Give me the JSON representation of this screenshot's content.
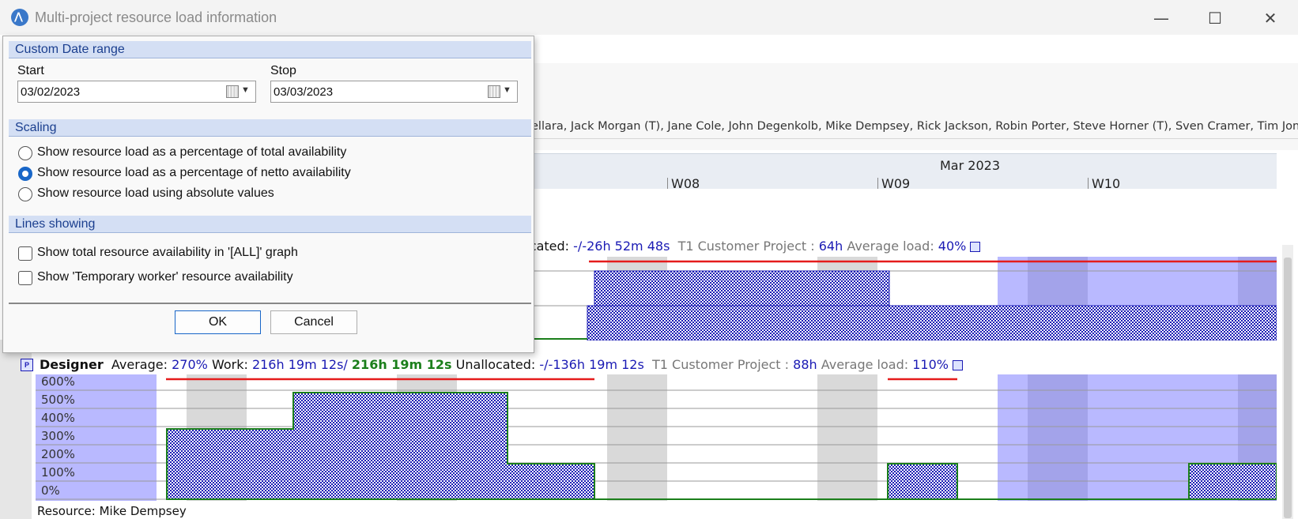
{
  "window": {
    "title": "Multi-project resource load information",
    "minimize": "—",
    "maximize": "☐",
    "close": "✕"
  },
  "resource_names": "ellara, Jack Morgan (T), Jane Cole, John Degenkolb, Mike Dempsey, Rick Jackson, Robin Porter, Steve Horner (T), Sven Cramer, Tim Jones",
  "timeline": {
    "month": "Mar 2023",
    "weeks": [
      "W08",
      "W09",
      "W10"
    ]
  },
  "top_row": {
    "unallocated_label": "ocated:",
    "unallocated_value": "-/-26h 52m 48s",
    "project_label": "T1 Customer Project :",
    "project_value": "64h",
    "avg_load_label": "Average load:",
    "avg_load_value": "40%"
  },
  "designer_row": {
    "name": "Designer",
    "average_label": "Average:",
    "average_value": "270%",
    "work_label": "Work:",
    "work_value": "216h 19m 12s/",
    "work_value2": "216h 19m 12s",
    "unallocated_label": "Unallocated:",
    "unallocated_value": "-/-136h 19m 12s",
    "project_label": "T1 Customer Project :",
    "project_value": "88h",
    "avg_load_label": "Average load:",
    "avg_load_value": "110%",
    "y_labels": [
      "600%",
      "500%",
      "400%",
      "300%",
      "200%",
      "100%",
      "0%"
    ]
  },
  "footer": "Resource: Mike Dempsey",
  "dialog": {
    "date_section": "Custom Date range",
    "start_label": "Start",
    "start_value": "03/02/2023",
    "stop_label": "Stop",
    "stop_value": "03/03/2023",
    "scaling_section": "Scaling",
    "scaling_options": [
      {
        "label": "Show resource load as a percentage of total availability",
        "selected": false
      },
      {
        "label": "Show resource load as a percentage of netto availability",
        "selected": true
      },
      {
        "label": "Show resource load using absolute values",
        "selected": false
      }
    ],
    "lines_section": "Lines showing",
    "line_options": [
      {
        "label": "Show total resource availability in '[ALL]' graph",
        "checked": false
      },
      {
        "label": "Show 'Temporary worker' resource availability",
        "checked": false
      }
    ],
    "ok": "OK",
    "cancel": "Cancel"
  },
  "colors": {
    "bar_fill": "#1a1ab4",
    "bar_outline": "#1b7f1b",
    "availability_band": "#b9b9ff",
    "weekend": "#d9d9d9",
    "red_line": "#e51c1c",
    "accent": "#1866c8"
  }
}
